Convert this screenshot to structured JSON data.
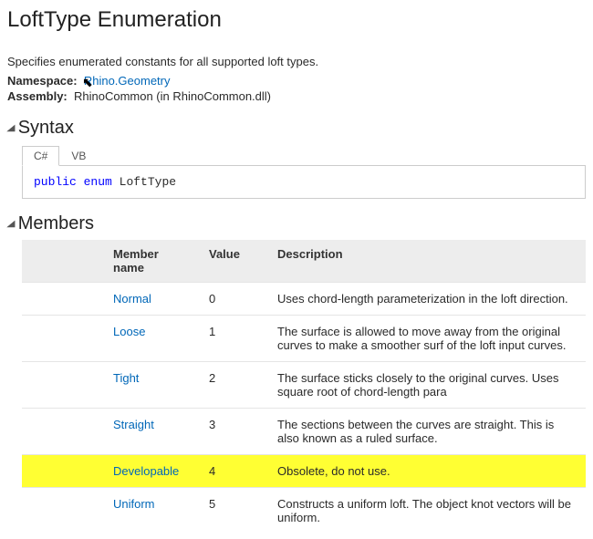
{
  "title": "LoftType Enumeration",
  "description": "Specifies enumerated constants for all supported loft types.",
  "meta": {
    "namespace_label": "Namespace:",
    "namespace_link": "Rhino.Geometry",
    "assembly_label": "Assembly:",
    "assembly_value": "RhinoCommon (in RhinoCommon.dll)"
  },
  "sections": {
    "syntax": "Syntax",
    "members": "Members"
  },
  "tabs": {
    "csharp": "C#",
    "vb": "VB"
  },
  "code": {
    "kw1": "public",
    "kw2": "enum",
    "typename": "LoftType"
  },
  "members_headers": {
    "name": "Member name",
    "value": "Value",
    "description": "Description"
  },
  "members": [
    {
      "name": "Normal",
      "value": "0",
      "desc": "Uses chord-length parameterization in the loft direction."
    },
    {
      "name": "Loose",
      "value": "1",
      "desc": "The surface is allowed to move away from the original curves to make a smoother surf of the loft input curves."
    },
    {
      "name": "Tight",
      "value": "2",
      "desc": "The surface sticks closely to the original curves. Uses square root of chord-length para"
    },
    {
      "name": "Straight",
      "value": "3",
      "desc": "The sections between the curves are straight. This is also known as a ruled surface."
    },
    {
      "name": "Developable",
      "value": "4",
      "desc": "Obsolete, do not use.",
      "highlight": true
    },
    {
      "name": "Uniform",
      "value": "5",
      "desc": "Constructs a uniform loft. The object knot vectors will be uniform."
    }
  ]
}
